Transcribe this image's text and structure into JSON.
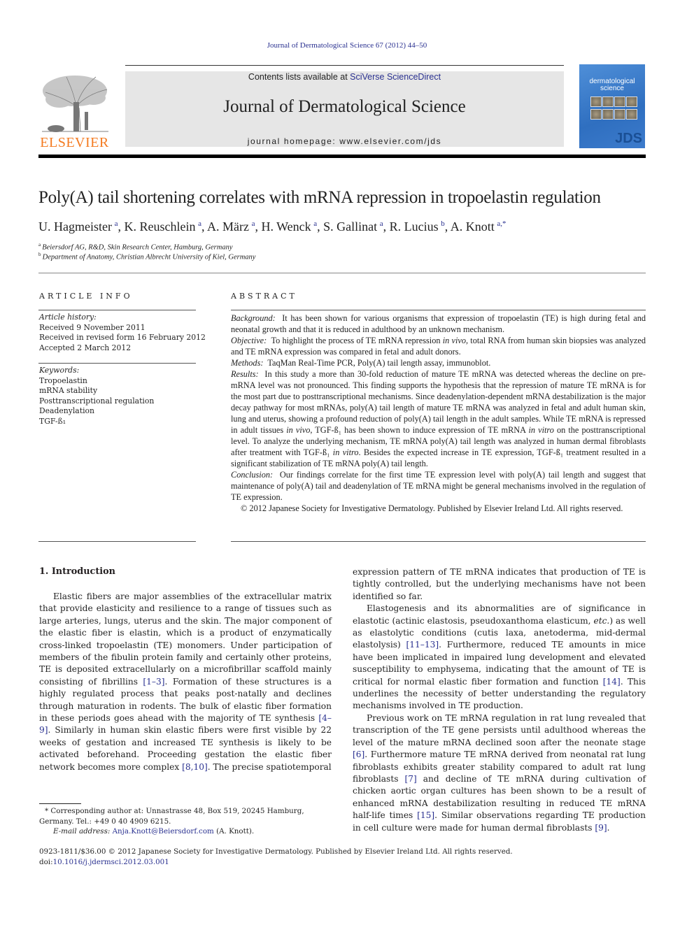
{
  "header": {
    "citation": "Journal of Dermatological Science 67 (2012) 44–50",
    "contents_prefix": "Contents lists available at ",
    "contents_link": "SciVerse ScienceDirect",
    "journal_name": "Journal of Dermatological Science",
    "homepage_prefix": "journal homepage: ",
    "homepage_url": "www.elsevier.com/jds",
    "publisher_logo_text": "ELSEVIER",
    "cover": {
      "title_line1": "dermatological",
      "title_line2": "science",
      "abbrev": "JDS"
    }
  },
  "article": {
    "title": "Poly(A) tail shortening correlates with mRNA repression in tropoelastin regulation",
    "authors": [
      {
        "name": "U. Hagmeister",
        "sup": "a"
      },
      {
        "name": "K. Reuschlein",
        "sup": "a"
      },
      {
        "name": "A. März",
        "sup": "a"
      },
      {
        "name": "H. Wenck",
        "sup": "a"
      },
      {
        "name": "S. Gallinat",
        "sup": "a"
      },
      {
        "name": "R. Lucius",
        "sup": "b"
      },
      {
        "name": "A. Knott",
        "sup": "a,*"
      }
    ],
    "affiliations": [
      {
        "key": "a",
        "text": "Beiersdorf AG, R&D, Skin Research Center, Hamburg, Germany"
      },
      {
        "key": "b",
        "text": "Department of Anatomy, Christian Albrecht University of Kiel, Germany"
      }
    ]
  },
  "article_info": {
    "heading": "ARTICLE INFO",
    "history_label": "Article history:",
    "history": [
      "Received 9 November 2011",
      "Received in revised form 16 February 2012",
      "Accepted 2 March 2012"
    ],
    "keywords_label": "Keywords:",
    "keywords": [
      "Tropoelastin",
      "mRNA stability",
      "Posttranscriptional regulation",
      "Deadenylation",
      "TGF-ß₁"
    ]
  },
  "abstract": {
    "heading": "ABSTRACT",
    "background_label": "Background:",
    "background": "It has been shown for various organisms that expression of tropoelastin (TE) is high during fetal and neonatal growth and that it is reduced in adulthood by an unknown mechanism.",
    "objective_label": "Objective:",
    "objective_a": "To highlight the process of TE mRNA repression ",
    "objective_em": "in vivo",
    "objective_b": ", total RNA from human skin biopsies was analyzed and TE mRNA expression was compared in fetal and adult donors.",
    "methods_label": "Methods:",
    "methods": "TaqMan Real-Time PCR, Poly(A) tail length assay, immunoblot.",
    "results_label": "Results:",
    "results_a": "In this study a more than 30-fold reduction of mature TE mRNA was detected whereas the decline on pre-mRNA level was not pronounced. This finding supports the hypothesis that the repression of mature TE mRNA is for the most part due to posttranscriptional mechanisms. Since deadenylation-dependent mRNA destabilization is the major decay pathway for most mRNAs, poly(A) tail length of mature TE mRNA was analyzed in fetal and adult human skin, lung and uterus, showing a profound reduction of poly(A) tail length in the adult samples. While TE mRNA is repressed in adult tissues ",
    "results_em1": "in vivo",
    "results_b": ", TGF-ß₁ has been shown to induce expression of TE mRNA ",
    "results_em2": "in vitro",
    "results_c": " on the posttranscriptional level. To analyze the underlying mechanism, TE mRNA poly(A) tail length was analyzed in human dermal fibroblasts after treatment with TGF-ß₁ ",
    "results_em3": "in vitro",
    "results_d": ". Besides the expected increase in TE expression, TGF-ß₁ treatment resulted in a significant stabilization of TE mRNA poly(A) tail length.",
    "conclusion_label": "Conclusion:",
    "conclusion": "Our findings correlate for the first time TE expression level with poly(A) tail length and suggest that maintenance of poly(A) tail and deadenylation of TE mRNA might be general mechanisms involved in the regulation of TE expression.",
    "copyright": "© 2012 Japanese Society for Investigative Dermatology. Published by Elsevier Ireland Ltd. All rights reserved."
  },
  "body": {
    "section_heading": "1.  Introduction",
    "left": {
      "p1_a": "Elastic fibers are major assemblies of the extracellular matrix that provide elasticity and resilience to a range of tissues such as large arteries, lungs, uterus and the skin. The major component of the elastic fiber is elastin, which is a product of enzymatically cross-linked tropoelastin (TE) monomers. Under participation of members of the fibulin protein family and certainly other proteins, TE is deposited extracellularly on a microfibrillar scaffold mainly consisting of fibrillins ",
      "ref1": "[1–3]",
      "p1_b": ". Formation of these structures is a highly regulated process that peaks post-natally and declines through maturation in rodents. The bulk of elastic fiber formation in these periods goes ahead with the majority of TE synthesis ",
      "ref2": "[4–9]",
      "p1_c": ". Similarly in human skin elastic fibers were first visible by 22 weeks of gestation and increased TE synthesis is likely to be activated beforehand. Proceeding gestation the elastic fiber network becomes more complex ",
      "ref3": "[8,10]",
      "p1_d": ". The precise spatiotemporal"
    },
    "right": {
      "p1": "expression pattern of TE mRNA indicates that production of TE is tightly controlled, but the underlying mechanisms have not been identified so far.",
      "p2_a": "Elastogenesis and its abnormalities are of significance in elastotic (actinic elastosis, pseudoxanthoma elasticum, ",
      "p2_em": "etc.",
      "p2_b": ") as well as elastolytic conditions (cutis laxa, anetoderma, mid-dermal elastolysis) ",
      "ref4": "[11–13]",
      "p2_c": ". Furthermore, reduced TE amounts in mice have been implicated in impaired lung development and elevated susceptibility to emphysema, indicating that the amount of TE is critical for normal elastic fiber formation and function ",
      "ref5": "[14]",
      "p2_d": ". This underlines the necessity of better understanding the regulatory mechanisms involved in TE production.",
      "p3_a": "Previous work on TE mRNA regulation in rat lung revealed that transcription of the TE gene persists until adulthood whereas the level of the mature mRNA declined soon after the neonate stage ",
      "ref6": "[6]",
      "p3_b": ". Furthermore mature TE mRNA derived from neonatal rat lung fibroblasts exhibits greater stability compared to adult rat lung fibroblasts ",
      "ref7": "[7]",
      "p3_c": " and decline of TE mRNA during cultivation of chicken aortic organ cultures has been shown to be a result of enhanced mRNA destabilization resulting in reduced TE mRNA half-life times ",
      "ref8": "[15]",
      "p3_d": ". Similar observations regarding TE production in cell culture were made for human dermal fibroblasts ",
      "ref9": "[9]",
      "p3_e": "."
    }
  },
  "footnote": {
    "corresponding": "* Corresponding author at: Unnastrasse 48, Box 519, 20245 Hamburg, Germany. Tel.: +49 0 40 4909 6215.",
    "email_label": "E-mail address:",
    "email": "Anja.Knott@Beiersdorf.com",
    "email_suffix": " (A. Knott)."
  },
  "bottom": {
    "issn_line": "0923-1811/$36.00 © 2012 Japanese Society for Investigative Dermatology. Published by Elsevier Ireland Ltd. All rights reserved.",
    "doi_prefix": "doi:",
    "doi": "10.1016/j.jdermsci.2012.03.001"
  }
}
